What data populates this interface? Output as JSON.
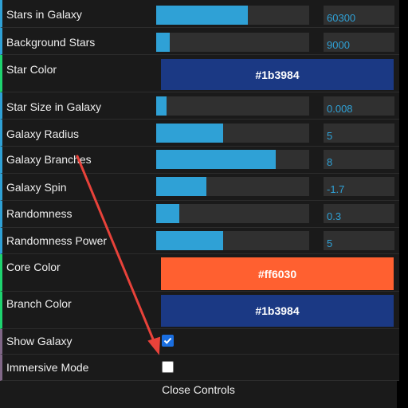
{
  "controls": {
    "stars_in_galaxy": {
      "label": "Stars in Galaxy",
      "value": "60300",
      "fill": 0.6
    },
    "background_stars": {
      "label": "Background Stars",
      "value": "9000",
      "fill": 0.09
    },
    "star_color": {
      "label": "Star Color",
      "value": "#1b3984"
    },
    "star_size": {
      "label": "Star Size in Galaxy",
      "value": "0.008",
      "fill": 0.07
    },
    "galaxy_radius": {
      "label": "Galaxy Radius",
      "value": "5",
      "fill": 0.44
    },
    "galaxy_branches": {
      "label": "Galaxy Branches",
      "value": "8",
      "fill": 0.78
    },
    "galaxy_spin": {
      "label": "Galaxy Spin",
      "value": "-1.7",
      "fill": 0.33
    },
    "randomness": {
      "label": "Randomness",
      "value": "0.3",
      "fill": 0.15
    },
    "randomness_power": {
      "label": "Randomness Power",
      "value": "5",
      "fill": 0.44
    },
    "core_color": {
      "label": "Core Color",
      "value": "#ff6030"
    },
    "branch_color": {
      "label": "Branch Color",
      "value": "#1b3984"
    },
    "show_galaxy": {
      "label": "Show Galaxy",
      "checked": true
    },
    "immersive_mode": {
      "label": "Immersive Mode",
      "checked": false
    }
  },
  "close_label": "Close Controls",
  "colors": {
    "panel_bg": "#1a1a1a",
    "slider_accent": "#2fa1d6",
    "color_accent": "#1ed36f",
    "bool_accent": "#806787",
    "arrow": "#e8423a"
  }
}
